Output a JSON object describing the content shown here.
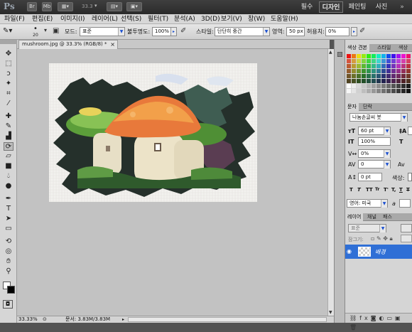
{
  "appbar": {
    "logo": "Ps",
    "btn_br": "Br",
    "btn_mb": "Mb",
    "zoom": "33.3",
    "workspaces": [
      "필수",
      "디자인",
      "페인팅",
      "사진"
    ],
    "active_workspace": "디자인"
  },
  "menu": [
    "파일(F)",
    "편집(E)",
    "이미지(I)",
    "레이어(L)",
    "선택(S)",
    "필터(T)",
    "분석(A)",
    "3D(D)",
    "보기(V)",
    "창(W)",
    "도움말(H)"
  ],
  "options": {
    "brush_size": "20",
    "mode_label": "모드:",
    "mode_value": "표준",
    "opacity_label": "불투명도:",
    "opacity_value": "100%",
    "style_label": "스타일:",
    "style_value": "단단히 중간",
    "area_label": "영역:",
    "area_value": "50 px",
    "tolerance_label": "허용치:",
    "tolerance_value": "0%"
  },
  "document": {
    "tab_title": "mushroom.jpg @ 33.3% (RGB/8) *",
    "close": "×"
  },
  "status": {
    "zoom": "33.33%",
    "doc_size": "문서: 3.83M/3.83M"
  },
  "swatches_panel": {
    "tabs": [
      "색상 견본",
      "스타일",
      "색상"
    ]
  },
  "character_panel": {
    "tabs": [
      "문자",
      "단락"
    ],
    "font_family": "나눔손글씨 붓",
    "font_size": "60 pt",
    "leading": "100%",
    "tracking": "0%",
    "kerning": "0",
    "baseline": "0 pt",
    "color_label": "색상:",
    "style_buttons": [
      "T",
      "T",
      "TT",
      "Tr",
      "T'",
      "T,",
      "T",
      "T"
    ],
    "language": "영어: 미국",
    "aa_label": "a"
  },
  "layers_panel": {
    "tabs": [
      "레이어",
      "채널",
      "패스"
    ],
    "blend_mode": "표준",
    "lock_label": "잠그기:",
    "layer_name": "배경"
  },
  "colors": {
    "accent": "#2f6fd6",
    "canvas_bg": "#c2c2c2"
  }
}
